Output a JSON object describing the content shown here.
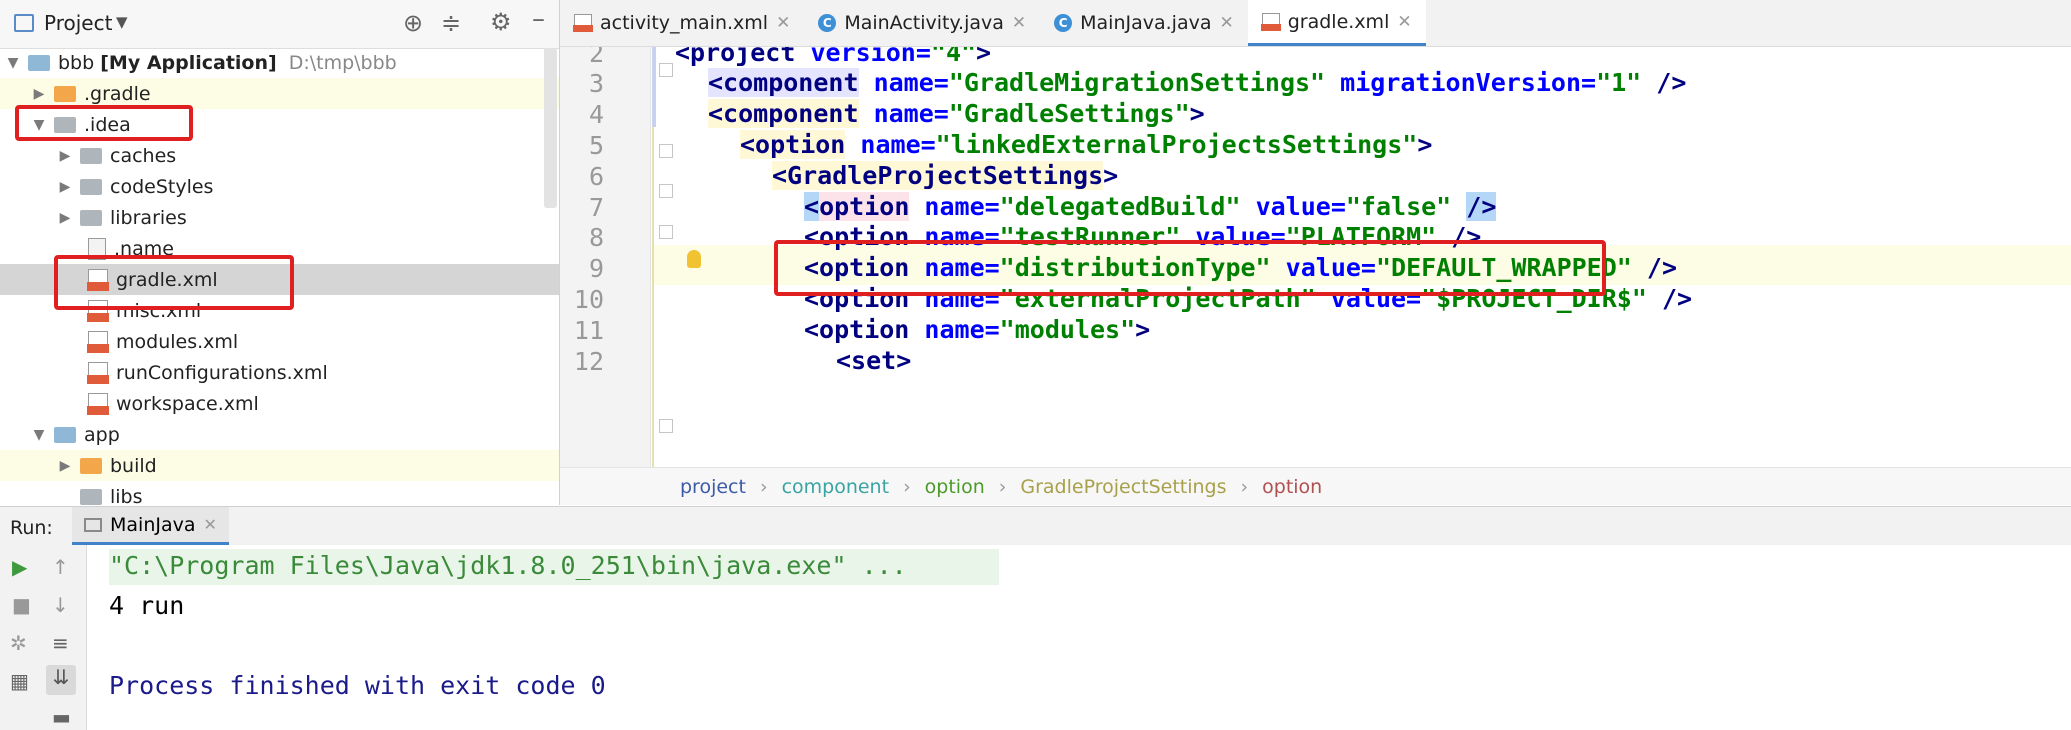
{
  "project_panel": {
    "title": "Project",
    "tree": [
      {
        "label": "bbb",
        "bold_suffix": "[My Application]",
        "path": "D:\\tmp\\bbb"
      },
      {
        "label": ".gradle"
      },
      {
        "label": ".idea"
      },
      {
        "label": "caches"
      },
      {
        "label": "codeStyles"
      },
      {
        "label": "libraries"
      },
      {
        "label": ".name"
      },
      {
        "label": "gradle.xml"
      },
      {
        "label": "misc.xml"
      },
      {
        "label": "modules.xml"
      },
      {
        "label": "runConfigurations.xml"
      },
      {
        "label": "workspace.xml"
      },
      {
        "label": "app"
      },
      {
        "label": "build"
      },
      {
        "label": "libs"
      }
    ]
  },
  "tabs": [
    {
      "label": "activity_main.xml",
      "icon": "xml-file-icon"
    },
    {
      "label": "MainActivity.java",
      "icon": "java-class-icon"
    },
    {
      "label": "MainJava.java",
      "icon": "java-class-icon"
    },
    {
      "label": "gradle.xml",
      "icon": "xml-file-icon",
      "active": true
    }
  ],
  "editor": {
    "line_numbers": [
      "2",
      "3",
      "4",
      "5",
      "6",
      "7",
      "8",
      "9",
      "10",
      "11",
      "12"
    ],
    "lines": [
      {
        "t1": "<project",
        "a1": " version=",
        "v1": "\"4\"",
        "t2": ">"
      },
      {
        "t1": "<component",
        "a1": " name=",
        "v1": "\"GradleMigrationSettings\"",
        "a2": " migrationVersion=",
        "v2": "\"1\"",
        "t2": " />"
      },
      {
        "t1": "<component",
        "a1": " name=",
        "v1": "\"GradleSettings\"",
        "t2": ">"
      },
      {
        "t1": "<option",
        "a1": " name=",
        "v1": "\"linkedExternalProjectsSettings\"",
        "t2": ">"
      },
      {
        "t1": "<GradleProjectSettings",
        "t2": ">"
      },
      {
        "t0": "<",
        "t1": "option",
        "a1": " name=",
        "v1": "\"delegatedBuild\"",
        "a2": " value=",
        "v2": "\"false\"",
        "t2": "/>"
      },
      {
        "t1": "<option",
        "a1": " name=",
        "v1": "\"testRunner\"",
        "a2": " value=",
        "v2": "\"PLATFORM\"",
        "t2": " />"
      },
      {
        "t1": "<option",
        "a1": " name=",
        "v1": "\"distributionType\"",
        "a2": " value=",
        "v2": "\"DEFAULT_WRAPPED\"",
        "t2": " />"
      },
      {
        "t1": "<option",
        "a1": " name=",
        "v1": "\"externalProjectPath\"",
        "a2": " value=",
        "v2": "\"$PROJECT_DIR$\"",
        "t2": " />"
      },
      {
        "t1": "<option",
        "a1": " name=",
        "v1": "\"modules\"",
        "t2": ">"
      },
      {
        "t1": "<set>"
      }
    ]
  },
  "breadcrumb": [
    {
      "label": "project",
      "color": "#3c5aa8"
    },
    {
      "label": "component",
      "color": "#3aa3a3"
    },
    {
      "label": "option",
      "color": "#4c9a2a"
    },
    {
      "label": "GradleProjectSettings",
      "color": "#a8a04a"
    },
    {
      "label": "option",
      "color": "#b05050"
    }
  ],
  "run": {
    "label": "Run:",
    "tab": "MainJava",
    "console": [
      "\"C:\\Program Files\\Java\\jdk1.8.0_251\\bin\\java.exe\" ...",
      "4 run",
      "",
      "Process finished with exit code 0"
    ]
  },
  "colors": {
    "highlight_box": "#e02020",
    "accent": "#4083c9"
  }
}
